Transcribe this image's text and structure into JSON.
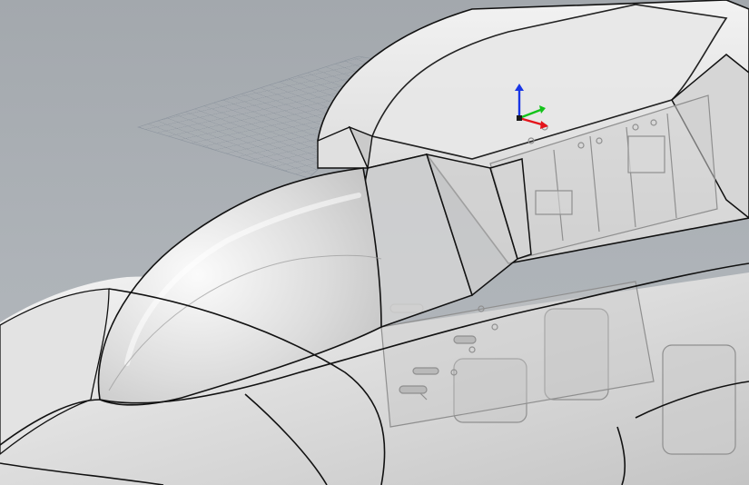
{
  "viewport": {
    "background_color": "#aab0b5",
    "grid_color": "#7f8894",
    "shell_color": "#dcdcdc",
    "edge_color": "#111111",
    "internal_structure_color": "#8a8a8a"
  },
  "gizmo": {
    "x_axis_color": "#e4141b",
    "y_axis_color": "#13c31a",
    "z_axis_color": "#1936e6",
    "origin_icon": "axis-gizmo-icon"
  },
  "model": {
    "object_icon": "helicopter-fuselage-icon"
  }
}
